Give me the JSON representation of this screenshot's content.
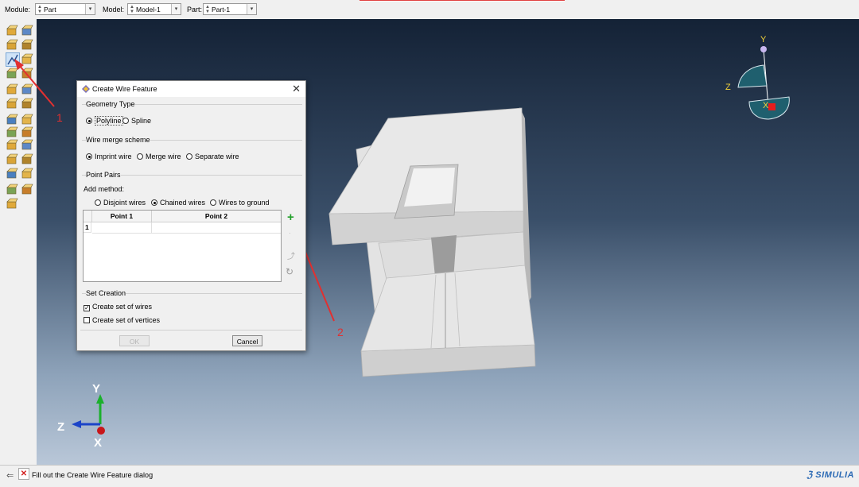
{
  "context_bar": {
    "module_label": "Module:",
    "module_value": "Part",
    "model_label": "Model:",
    "model_value": "Model-1",
    "part_label": "Part:",
    "part_value": "Part-1"
  },
  "toolbox": {
    "tools": [
      "part-manager-icon",
      "create-part-icon",
      "create-solid-icon",
      "create-shell-icon",
      "create-wire-icon",
      "create-cut-icon",
      "create-fillet-icon",
      "repair-icon",
      "partition-face-icon",
      "partition-cell-icon",
      "query-icon",
      "datum-point-icon",
      "datum-axis-icon",
      "datum-plane-icon",
      "datum-csys-icon",
      "reference-point-icon",
      "coordinate-icon",
      "virtual-topology-icon",
      "set-manager-icon",
      "surface-manager-icon",
      "feature-tools-icon",
      "edit-feature-icon",
      "wrench-icon",
      "mesh-icon",
      "assembly-icon"
    ]
  },
  "dialog": {
    "title": "Create Wire Feature",
    "geometry_type": {
      "label": "Geometry Type",
      "polyline": "Polyline",
      "spline": "Spline",
      "selected": "Polyline"
    },
    "wire_merge": {
      "label": "Wire merge scheme",
      "imprint": "Imprint wire",
      "merge": "Merge wire",
      "separate": "Separate wire",
      "selected": "Imprint wire"
    },
    "point_pairs": {
      "label": "Point Pairs",
      "add_method_label": "Add method:",
      "disjoint": "Disjoint wires",
      "chained": "Chained wires",
      "ground": "Wires to ground",
      "selected": "Chained wires",
      "columns": [
        "Point 1",
        "Point 2"
      ],
      "rows": [
        {
          "index": "1",
          "point1": "",
          "point2": ""
        }
      ]
    },
    "set_creation": {
      "label": "Set Creation",
      "set_of_wires": "Create set of wires",
      "set_of_wires_checked": true,
      "set_of_vertices": "Create set of vertices",
      "set_of_vertices_checked": false
    },
    "ok_label": "OK",
    "cancel_label": "Cancel"
  },
  "viewport": {
    "orientation_triad": {
      "y": "Y",
      "z": "Z",
      "x": "X"
    },
    "axis_triad": {
      "y": "Y",
      "z": "Z",
      "x": "X"
    },
    "annotations": {
      "one": "1",
      "two": "2"
    }
  },
  "status_bar": {
    "message": "Fill out the Create Wire Feature dialog",
    "brand": "SIMULIA"
  },
  "colors": {
    "viewport_top": "#142236",
    "viewport_bottom": "#b9c7d8",
    "annotation": "#e13030",
    "part_face": "#dcdcdc"
  }
}
